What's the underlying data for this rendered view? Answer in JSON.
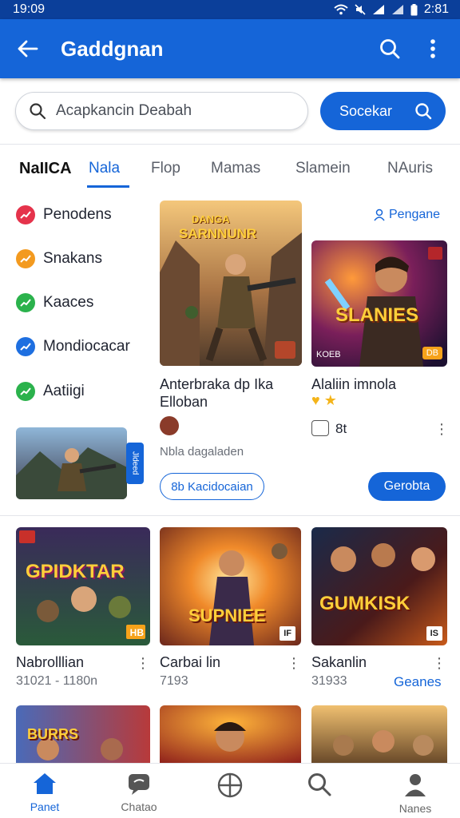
{
  "status_bar": {
    "time": "19:09",
    "right": "2:81"
  },
  "app_bar": {
    "title": "Gaddgnan"
  },
  "search": {
    "placeholder": "Acapkancin Deabah",
    "button_label": "Socekar"
  },
  "tabs": [
    {
      "label": "NaIICA"
    },
    {
      "label": "Nala",
      "active": true
    },
    {
      "label": "Flop"
    },
    {
      "label": "Mamas"
    },
    {
      "label": "Slamein"
    },
    {
      "label": "NAuris"
    }
  ],
  "side_list": [
    {
      "label": "Penodens",
      "color": "#e5334b"
    },
    {
      "label": "Snakans",
      "color": "#f39a1f"
    },
    {
      "label": "Kaaces",
      "color": "#2bb24c"
    },
    {
      "label": "Mondiocacar",
      "color": "#1e6fe0"
    },
    {
      "label": "Aatiigi",
      "color": "#2bb24c"
    }
  ],
  "side_thumb_badge": "Jldeed",
  "feature": {
    "owner_link": "Pengane",
    "card1": {
      "title": "Anterbraka dp Ika Elloban",
      "thumb_text_1": "DANGA",
      "thumb_text_2": "SARNNUNR",
      "meta": "Nbla dagaladen",
      "button": "8b Kacidocaian"
    },
    "card2": {
      "title": "Alaliin imnola",
      "thumb_text": "SLANIES",
      "thumb_corner": "KOEB",
      "thumb_corner_right": "DB",
      "count": "8t",
      "button": "Gerobta"
    }
  },
  "grid_row_1": [
    {
      "title": "Nabrolllian",
      "meta": "31021 - 1180n",
      "art": "GPIDKTAR",
      "badge": "HB"
    },
    {
      "title": "Carbai lin",
      "meta": "7193",
      "art": "SUPNIEE",
      "badge": "IF"
    },
    {
      "title": "Sakanlin",
      "meta": "31933",
      "art": "GUMKISK",
      "badge": "IS",
      "link": "Geanes"
    }
  ],
  "grid_row_2": [
    {
      "art": "BURRS"
    },
    {
      "art": ""
    },
    {
      "art": ""
    }
  ],
  "bottom_nav": [
    {
      "label": "Panet",
      "icon": "home-icon",
      "active": true
    },
    {
      "label": "Chatao",
      "icon": "chat-icon"
    },
    {
      "label": "",
      "icon": "crosshair-icon"
    },
    {
      "label": "",
      "icon": "search-icon"
    },
    {
      "label": "Nanes",
      "icon": "profile-icon"
    }
  ],
  "colors": {
    "primary": "#1565d8",
    "status_bar": "#0b3f9a"
  }
}
